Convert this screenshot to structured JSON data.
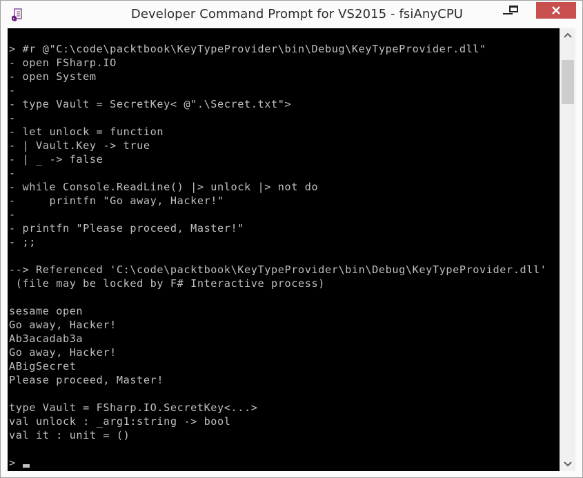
{
  "window": {
    "title": "Developer Command Prompt for VS2015 - fsiAnyCPU",
    "icon": "visual-studio-cmd-icon",
    "controls": {
      "minimize": "minimize-icon",
      "maximize": "maximize-icon",
      "close": "close-icon",
      "close_color": "#c7504f"
    }
  },
  "console": {
    "background": "#000000",
    "foreground": "#c0c0c0",
    "lines": [
      "> #r @\"C:\\code\\packtbook\\KeyTypeProvider\\bin\\Debug\\KeyTypeProvider.dll\"",
      "- open FSharp.IO",
      "- open System",
      "-",
      "- type Vault = SecretKey< @\".\\Secret.txt\">",
      "-",
      "- let unlock = function",
      "- | Vault.Key -> true",
      "- | _ -> false",
      "-",
      "- while Console.ReadLine() |> unlock |> not do",
      "-     printfn \"Go away, Hacker!\"",
      "-",
      "- printfn \"Please proceed, Master!\"",
      "- ;;",
      "",
      "--> Referenced 'C:\\code\\packtbook\\KeyTypeProvider\\bin\\Debug\\KeyTypeProvider.dll'",
      " (file may be locked by F# Interactive process)",
      "",
      "sesame open",
      "Go away, Hacker!",
      "Ab3acadab3a",
      "Go away, Hacker!",
      "ABigSecret",
      "Please proceed, Master!",
      "",
      "type Vault = FSharp.IO.SecretKey<...>",
      "val unlock : _arg1:string -> bool",
      "val it : unit = ()",
      ""
    ],
    "prompt": ">"
  },
  "scrollbar": {
    "up_icon": "chevron-up-icon",
    "down_icon": "chevron-down-icon",
    "position_fraction": 0.0
  }
}
